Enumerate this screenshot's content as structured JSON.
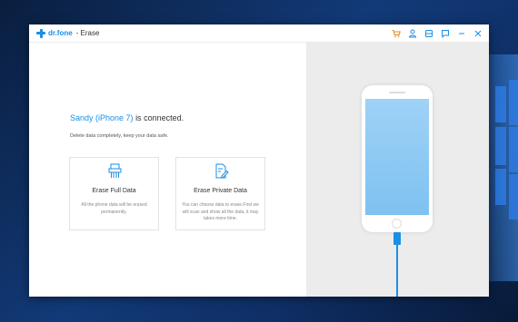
{
  "app": {
    "brand": "dr.fone",
    "module": "- Erase"
  },
  "titlebar_icons": [
    "cart-icon",
    "user-icon",
    "save-icon",
    "feedback-icon",
    "minimize-icon",
    "close-icon"
  ],
  "main": {
    "device_name": "Sandy (iPhone 7)",
    "connected_text": "is connected.",
    "description": "Delete data completely, keep your data safe.",
    "cards": [
      {
        "title": "Erase Full Data",
        "desc": "All the phone data will be erased permanently.",
        "icon": "shredder-icon"
      },
      {
        "title": "Erase Private Data",
        "desc": "You can choose data to erase.First we will scan and show all the data, it may takes more time.",
        "icon": "document-edit-icon"
      }
    ]
  },
  "colors": {
    "accent": "#1a8fe6",
    "titlebar_icon": "#e08a1e",
    "panel_gray": "#ececec"
  }
}
